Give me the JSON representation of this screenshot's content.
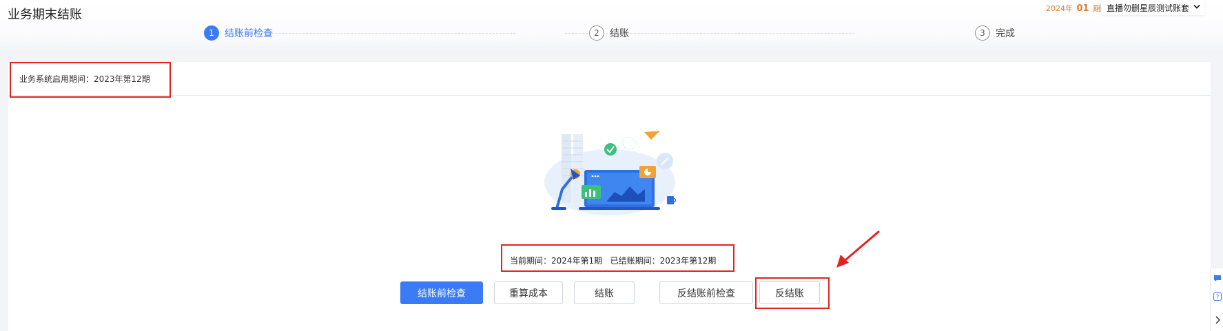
{
  "header": {
    "title": "业务期末结账",
    "period_year": "2024年",
    "period_num": "01",
    "period_unit": "期",
    "account_name": "直播勿删星辰测试账套"
  },
  "steps": [
    {
      "num": "1",
      "label": "结账前检查",
      "active": true
    },
    {
      "num": "2",
      "label": "结账",
      "active": false
    },
    {
      "num": "3",
      "label": "完成",
      "active": false
    }
  ],
  "card": {
    "start_period": "业务系统启用期间：2023年第12期",
    "current_period": "当前期间：2024年第1期   已结账期间：2023年第12期"
  },
  "buttons": {
    "precheck": "结账前检查",
    "recalc_cost": "重算成本",
    "close": "结账",
    "reverse_precheck": "反结账前检查",
    "reverse_close": "反结账"
  },
  "colors": {
    "primary": "#3b7bf6",
    "highlight": "#e0231f",
    "period": "#e07a2e"
  },
  "icons": {
    "account_dropdown": "chevron-down-icon",
    "side_tools": [
      "chat-icon",
      "help-icon",
      "chevron-right-icon"
    ]
  }
}
